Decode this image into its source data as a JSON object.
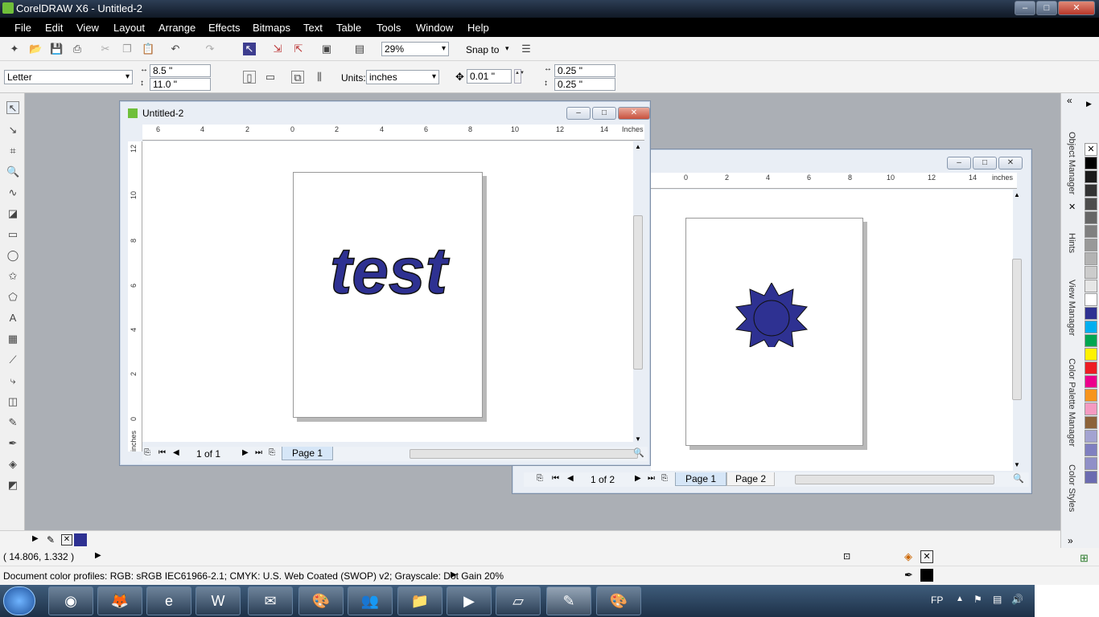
{
  "app": {
    "title": "CorelDRAW X6 - Untitled-2",
    "window_buttons": {
      "minimize": "–",
      "maximize": "□",
      "close": "✕"
    }
  },
  "menu": [
    "File",
    "Edit",
    "View",
    "Layout",
    "Arrange",
    "Effects",
    "Bitmaps",
    "Text",
    "Table",
    "Tools",
    "Window",
    "Help"
  ],
  "toolbar": {
    "zoom": "29%",
    "snap": "Snap to"
  },
  "propbar": {
    "paper": "Letter",
    "width": "8.5 \"",
    "height": "11.0 \"",
    "units_label": "Units:",
    "units": "inches",
    "nudge": "0.01 \"",
    "dup_x": "0.25 \"",
    "dup_y": "0.25 \""
  },
  "doc1": {
    "title": "Untitled-2",
    "ruler_h": [
      "6",
      "4",
      "2",
      "0",
      "2",
      "4",
      "6",
      "8",
      "10",
      "12",
      "14",
      "Inches"
    ],
    "ruler_v": [
      "12",
      "10",
      "8",
      "6",
      "4",
      "2",
      "0"
    ],
    "ruler_unit": "inches",
    "text_content": "test",
    "page_count": "1 of 1",
    "tab": "Page 1"
  },
  "doc2": {
    "ruler_h": [
      "0",
      "2",
      "4",
      "6",
      "8",
      "10",
      "12",
      "14",
      "inches"
    ],
    "ruler_unit": "inches",
    "page_count": "1 of 2",
    "tabs": [
      "Page 1",
      "Page 2"
    ]
  },
  "dockers": [
    "Object Manager",
    "Hints",
    "View Manager",
    "Color Palette Manager",
    "Color Styles"
  ],
  "palette": [
    "none",
    "#000000",
    "#1a1a1a",
    "#333333",
    "#4d4d4d",
    "#666666",
    "#808080",
    "#999999",
    "#b3b3b3",
    "#cccccc",
    "#e6e6e6",
    "#ffffff",
    "#2e3192",
    "#00aeef",
    "#00a651",
    "#fff200",
    "#ed1c24",
    "#ec008c",
    "#f7941d",
    "#f49ac1",
    "#8c6239",
    "#a3a3d1",
    "#7f7fc0",
    "#9090c8",
    "#6b6bb0"
  ],
  "fill_color": "#2e3192",
  "status": {
    "coords": "( 14.806, 1.332 )",
    "profiles": "Document color profiles: RGB: sRGB IEC61966-2.1; CMYK: U.S. Web Coated (SWOP) v2; Grayscale: Dot Gain 20%"
  },
  "taskbar": {
    "lang": "FP",
    "apps": [
      "chrome-icon",
      "firefox-icon",
      "ie-icon",
      "word-icon",
      "outlook-icon",
      "paint-icon",
      "people-icon",
      "folder-icon",
      "media-icon",
      "notes-icon",
      "coreldraw-icon",
      "palette-icon"
    ]
  }
}
